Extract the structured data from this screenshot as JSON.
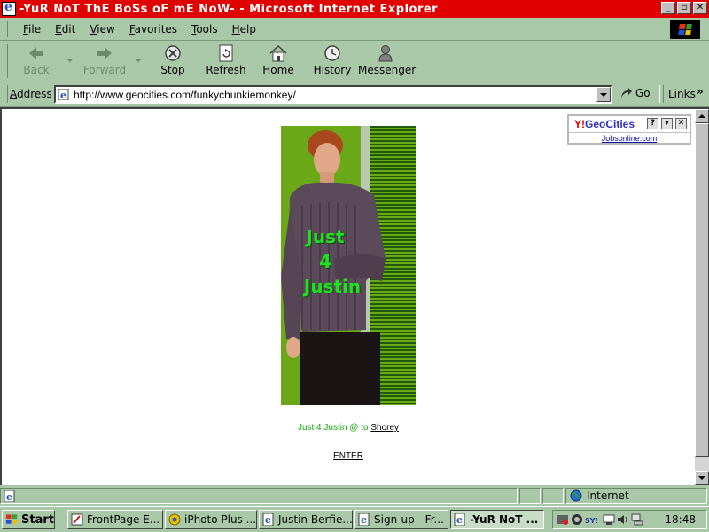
{
  "window": {
    "title": "-YuR NoT ThE BoSs oF mE NoW- - Microsoft Internet Explorer"
  },
  "menu": {
    "items": [
      "File",
      "Edit",
      "View",
      "Favorites",
      "Tools",
      "Help"
    ]
  },
  "toolbar": {
    "back": "Back",
    "forward": "Forward",
    "stop": "Stop",
    "refresh": "Refresh",
    "home": "Home",
    "history": "History",
    "messenger": "Messenger"
  },
  "address": {
    "label": "Address",
    "url": "http://www.geocities.com/funkychunkiemonkey/",
    "go": "Go",
    "links": "Links"
  },
  "page": {
    "banner_line1": "Just",
    "banner_line2": "4",
    "banner_line3": "Justin",
    "credit_prefix": "Just 4 Justin @ to",
    "credit_link": "Shorey",
    "enter": "ENTER"
  },
  "geocities": {
    "logo_y": "Y!",
    "logo_name": "GeoCities",
    "help": "?",
    "sublink": "Jobsonline.com"
  },
  "status": {
    "zone": "Internet"
  },
  "taskbar": {
    "start": "Start",
    "tasks": [
      "FrontPage E...",
      "iPhoto Plus ...",
      "Justin Berfie...",
      "Sign-up - Fr...",
      "-YuR NoT ..."
    ],
    "clock": "18:48"
  },
  "colors": {
    "title_bar": "#e00000",
    "chrome": "#a8c8a8",
    "banner_text": "#20e020",
    "credit_text": "#10b010"
  }
}
